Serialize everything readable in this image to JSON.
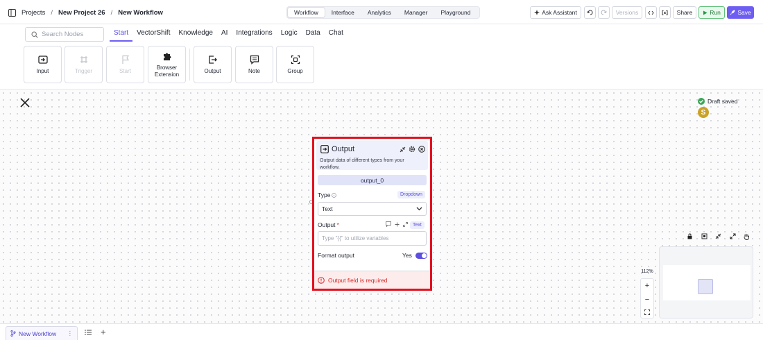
{
  "breadcrumb": {
    "projects": "Projects",
    "sep": "/",
    "project": "New Project 26",
    "workflow": "New Workflow"
  },
  "nav_tabs": [
    "Workflow",
    "Interface",
    "Analytics",
    "Manager",
    "Playground"
  ],
  "header_actions": {
    "ask_assistant": "Ask Assistant",
    "versions": "Versions",
    "share": "Share",
    "run": "Run",
    "save": "Save"
  },
  "search": {
    "placeholder": "Search Nodes"
  },
  "category_tabs": [
    "Start",
    "VectorShift",
    "Knowledge",
    "AI",
    "Integrations",
    "Logic",
    "Data",
    "Chat"
  ],
  "node_cards": [
    "Input",
    "Trigger",
    "Start",
    "Browser Extension",
    "Output",
    "Note",
    "Group"
  ],
  "status": {
    "draft": "Draft saved",
    "avatar_letter": "S"
  },
  "node": {
    "title": "Output",
    "description": "Output data of different types from your workflow.",
    "name": "output_0",
    "type_label": "Type",
    "type_tag": "Dropdown",
    "type_value": "Text",
    "output_label": "Output",
    "required_mark": "*",
    "output_tag": "Text",
    "output_placeholder": "Type \"{{\" to utilize variables",
    "format_label": "Format output",
    "format_value": "Yes",
    "error": "Output field is required"
  },
  "zoom": {
    "level": "112%",
    "in": "+",
    "out": "−"
  },
  "bottom_tab": {
    "label": "New Workflow",
    "menu": "⋮",
    "add": "+"
  },
  "colors": {
    "accent": "#6d5df2",
    "error": "#e3101f",
    "run": "#1e7a37"
  }
}
